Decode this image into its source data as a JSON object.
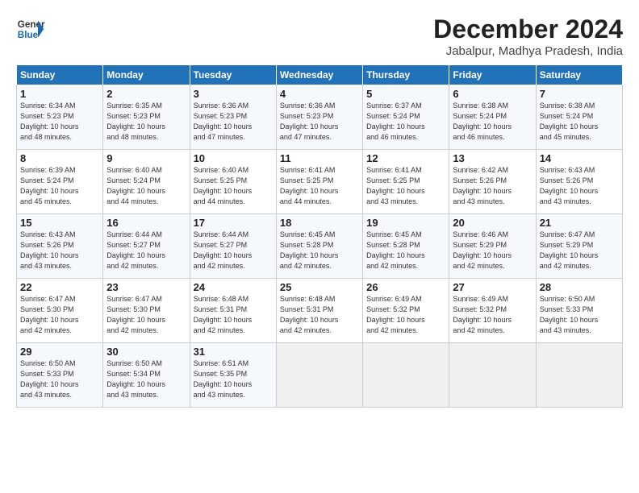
{
  "header": {
    "logo_line1": "General",
    "logo_line2": "Blue",
    "title": "December 2024",
    "location": "Jabalpur, Madhya Pradesh, India"
  },
  "weekdays": [
    "Sunday",
    "Monday",
    "Tuesday",
    "Wednesday",
    "Thursday",
    "Friday",
    "Saturday"
  ],
  "weeks": [
    [
      {
        "day": "1",
        "info": "Sunrise: 6:34 AM\nSunset: 5:23 PM\nDaylight: 10 hours\nand 48 minutes."
      },
      {
        "day": "2",
        "info": "Sunrise: 6:35 AM\nSunset: 5:23 PM\nDaylight: 10 hours\nand 48 minutes."
      },
      {
        "day": "3",
        "info": "Sunrise: 6:36 AM\nSunset: 5:23 PM\nDaylight: 10 hours\nand 47 minutes."
      },
      {
        "day": "4",
        "info": "Sunrise: 6:36 AM\nSunset: 5:23 PM\nDaylight: 10 hours\nand 47 minutes."
      },
      {
        "day": "5",
        "info": "Sunrise: 6:37 AM\nSunset: 5:24 PM\nDaylight: 10 hours\nand 46 minutes."
      },
      {
        "day": "6",
        "info": "Sunrise: 6:38 AM\nSunset: 5:24 PM\nDaylight: 10 hours\nand 46 minutes."
      },
      {
        "day": "7",
        "info": "Sunrise: 6:38 AM\nSunset: 5:24 PM\nDaylight: 10 hours\nand 45 minutes."
      }
    ],
    [
      {
        "day": "8",
        "info": "Sunrise: 6:39 AM\nSunset: 5:24 PM\nDaylight: 10 hours\nand 45 minutes."
      },
      {
        "day": "9",
        "info": "Sunrise: 6:40 AM\nSunset: 5:24 PM\nDaylight: 10 hours\nand 44 minutes."
      },
      {
        "day": "10",
        "info": "Sunrise: 6:40 AM\nSunset: 5:25 PM\nDaylight: 10 hours\nand 44 minutes."
      },
      {
        "day": "11",
        "info": "Sunrise: 6:41 AM\nSunset: 5:25 PM\nDaylight: 10 hours\nand 44 minutes."
      },
      {
        "day": "12",
        "info": "Sunrise: 6:41 AM\nSunset: 5:25 PM\nDaylight: 10 hours\nand 43 minutes."
      },
      {
        "day": "13",
        "info": "Sunrise: 6:42 AM\nSunset: 5:26 PM\nDaylight: 10 hours\nand 43 minutes."
      },
      {
        "day": "14",
        "info": "Sunrise: 6:43 AM\nSunset: 5:26 PM\nDaylight: 10 hours\nand 43 minutes."
      }
    ],
    [
      {
        "day": "15",
        "info": "Sunrise: 6:43 AM\nSunset: 5:26 PM\nDaylight: 10 hours\nand 43 minutes."
      },
      {
        "day": "16",
        "info": "Sunrise: 6:44 AM\nSunset: 5:27 PM\nDaylight: 10 hours\nand 42 minutes."
      },
      {
        "day": "17",
        "info": "Sunrise: 6:44 AM\nSunset: 5:27 PM\nDaylight: 10 hours\nand 42 minutes."
      },
      {
        "day": "18",
        "info": "Sunrise: 6:45 AM\nSunset: 5:28 PM\nDaylight: 10 hours\nand 42 minutes."
      },
      {
        "day": "19",
        "info": "Sunrise: 6:45 AM\nSunset: 5:28 PM\nDaylight: 10 hours\nand 42 minutes."
      },
      {
        "day": "20",
        "info": "Sunrise: 6:46 AM\nSunset: 5:29 PM\nDaylight: 10 hours\nand 42 minutes."
      },
      {
        "day": "21",
        "info": "Sunrise: 6:47 AM\nSunset: 5:29 PM\nDaylight: 10 hours\nand 42 minutes."
      }
    ],
    [
      {
        "day": "22",
        "info": "Sunrise: 6:47 AM\nSunset: 5:30 PM\nDaylight: 10 hours\nand 42 minutes."
      },
      {
        "day": "23",
        "info": "Sunrise: 6:47 AM\nSunset: 5:30 PM\nDaylight: 10 hours\nand 42 minutes."
      },
      {
        "day": "24",
        "info": "Sunrise: 6:48 AM\nSunset: 5:31 PM\nDaylight: 10 hours\nand 42 minutes."
      },
      {
        "day": "25",
        "info": "Sunrise: 6:48 AM\nSunset: 5:31 PM\nDaylight: 10 hours\nand 42 minutes."
      },
      {
        "day": "26",
        "info": "Sunrise: 6:49 AM\nSunset: 5:32 PM\nDaylight: 10 hours\nand 42 minutes."
      },
      {
        "day": "27",
        "info": "Sunrise: 6:49 AM\nSunset: 5:32 PM\nDaylight: 10 hours\nand 42 minutes."
      },
      {
        "day": "28",
        "info": "Sunrise: 6:50 AM\nSunset: 5:33 PM\nDaylight: 10 hours\nand 43 minutes."
      }
    ],
    [
      {
        "day": "29",
        "info": "Sunrise: 6:50 AM\nSunset: 5:33 PM\nDaylight: 10 hours\nand 43 minutes."
      },
      {
        "day": "30",
        "info": "Sunrise: 6:50 AM\nSunset: 5:34 PM\nDaylight: 10 hours\nand 43 minutes."
      },
      {
        "day": "31",
        "info": "Sunrise: 6:51 AM\nSunset: 5:35 PM\nDaylight: 10 hours\nand 43 minutes."
      },
      {
        "day": "",
        "info": ""
      },
      {
        "day": "",
        "info": ""
      },
      {
        "day": "",
        "info": ""
      },
      {
        "day": "",
        "info": ""
      }
    ]
  ]
}
